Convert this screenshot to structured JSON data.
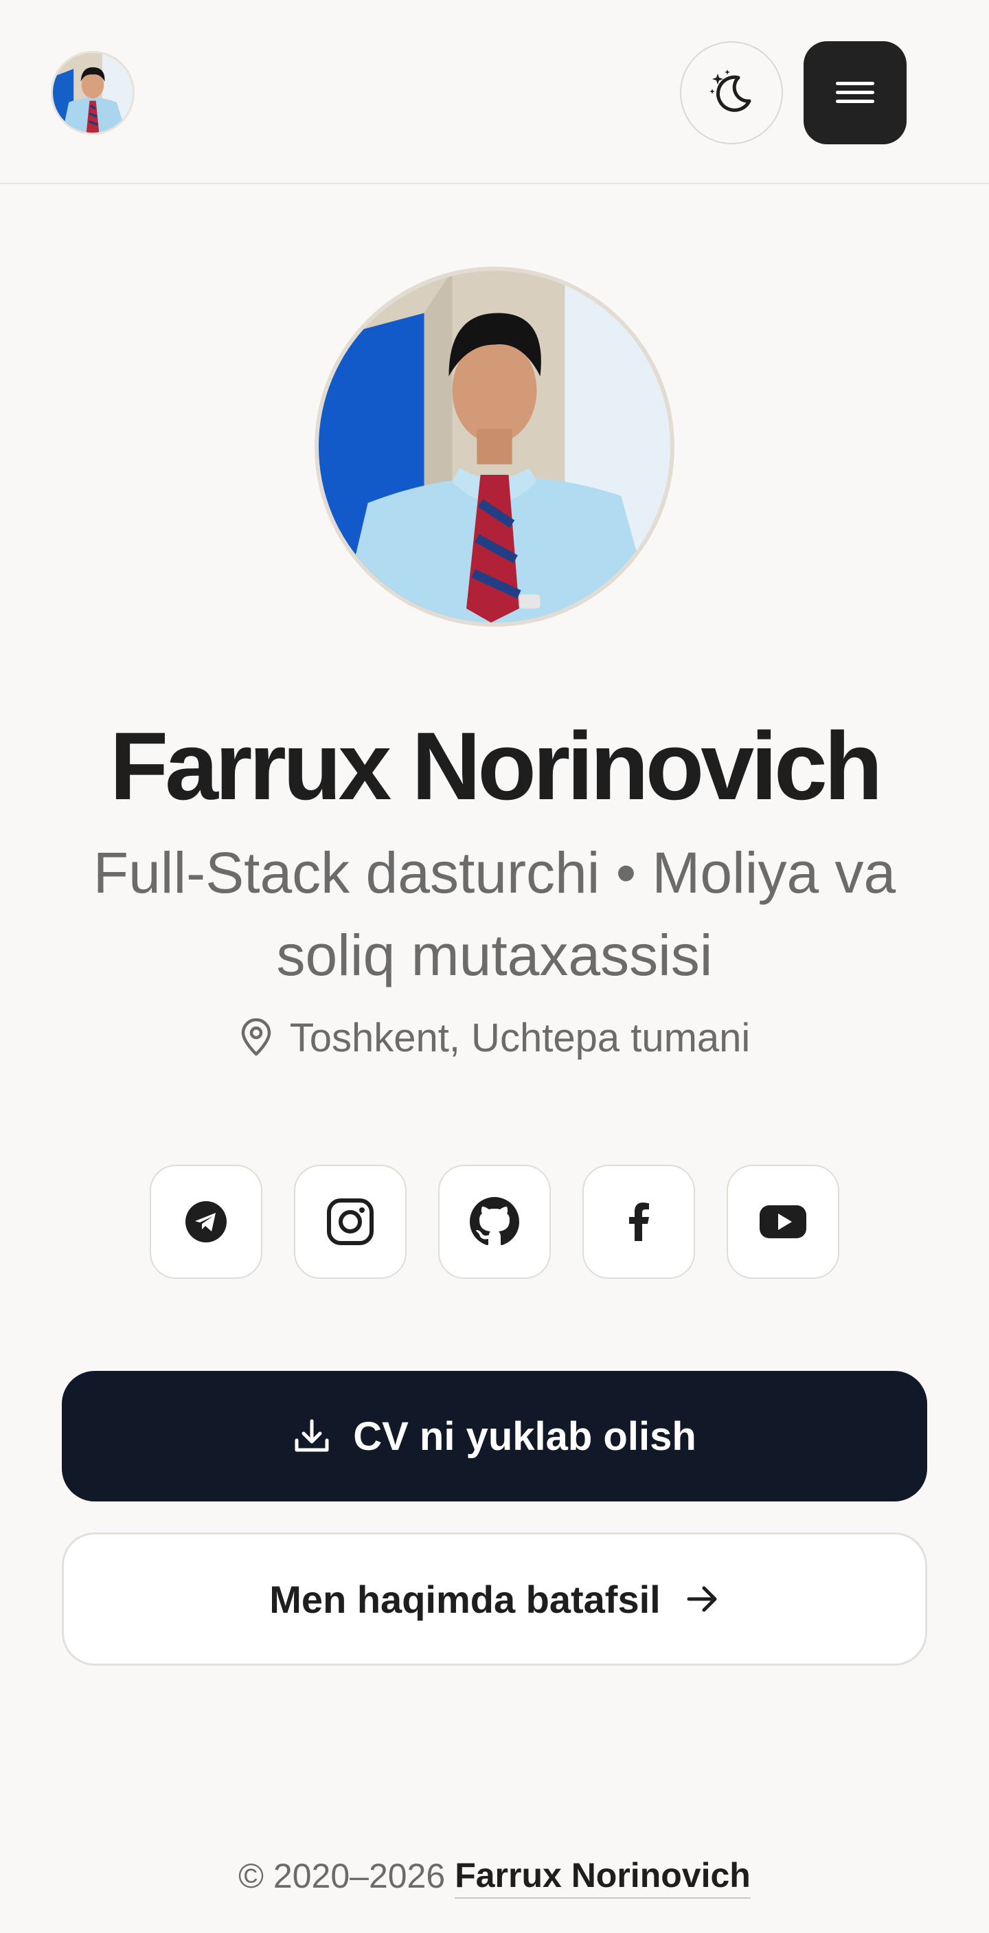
{
  "header": {
    "avatar_alt": "Farrux Norinovich",
    "theme_icon": "moon-stars-icon",
    "menu_icon": "menu-icon"
  },
  "profile": {
    "name": "Farrux Norinovich",
    "subtitle": "Full-Stack dasturchi • Moliya va soliq mutaxassisi",
    "location": "Toshkent, Uchtepa tumani"
  },
  "socials": [
    {
      "icon": "telegram-icon"
    },
    {
      "icon": "instagram-icon"
    },
    {
      "icon": "github-icon"
    },
    {
      "icon": "facebook-icon"
    },
    {
      "icon": "youtube-icon"
    }
  ],
  "actions": {
    "download_cv": "CV ni yuklab olish",
    "about_more": "Men haqimda batafsil"
  },
  "footer": {
    "copyright": "© 2020–2026",
    "owner": "Farrux Norinovich"
  },
  "colors": {
    "background": "#f9f8f6",
    "primary_button": "#111827",
    "menu_button": "#222222",
    "muted_text": "#6b6b6b"
  }
}
